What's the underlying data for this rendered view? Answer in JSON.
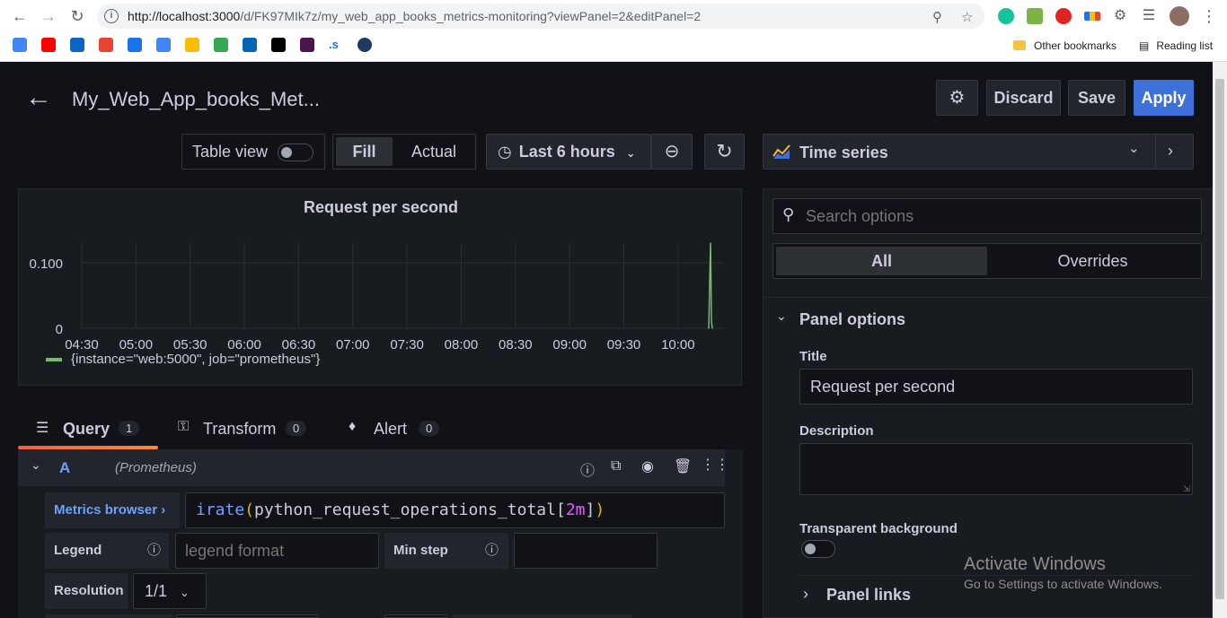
{
  "browser": {
    "url_host": "http://localhost:3000",
    "url_path": "/d/FK97MIk7z/my_web_app_books_metrics-monitoring?viewPanel=2&editPanel=2",
    "bookmarks_other": "Other bookmarks",
    "bookmarks_reading": "Reading list"
  },
  "header": {
    "title": "My_Web_App_books_Met...",
    "discard": "Discard",
    "save": "Save",
    "apply": "Apply"
  },
  "toolbar": {
    "table_view": "Table view",
    "fill": "Fill",
    "actual": "Actual",
    "time_range": "Last 6 hours",
    "viz_type": "Time series"
  },
  "chart_data": {
    "type": "line",
    "title": "Request per second",
    "x_ticks": [
      "04:30",
      "05:00",
      "05:30",
      "06:00",
      "06:30",
      "07:00",
      "07:30",
      "08:00",
      "08:30",
      "09:00",
      "09:30",
      "10:00"
    ],
    "y_ticks": [
      "0",
      "0.100"
    ],
    "ylim": [
      0,
      0.13
    ],
    "series": [
      {
        "name": "{instance=\"web:5000\", job=\"prometheus\"}",
        "color": "#73bf69",
        "x": [
          "10:17",
          "10:17:30",
          "10:18",
          "10:18:30",
          "10:19"
        ],
        "values": [
          0,
          0.07,
          0.13,
          0.01,
          0
        ]
      }
    ],
    "legend": "bottom-left",
    "grid": true
  },
  "tabs": [
    {
      "label": "Query",
      "count": "1"
    },
    {
      "label": "Transform",
      "count": "0"
    },
    {
      "label": "Alert",
      "count": "0"
    }
  ],
  "query": {
    "ref": "A",
    "datasource": "(Prometheus)",
    "metrics_browser": "Metrics browser",
    "expr_fn": "irate",
    "expr_metric": "python_request_operations_total",
    "expr_range": "2m",
    "legend_label": "Legend",
    "legend_placeholder": "legend format",
    "min_step_label": "Min step",
    "resolution_label": "Resolution",
    "resolution_value": "1/1"
  },
  "options": {
    "search_placeholder": "Search options",
    "tab_all": "All",
    "tab_overrides": "Overrides",
    "section": "Panel options",
    "title_label": "Title",
    "title_value": "Request per second",
    "description_label": "Description",
    "transparent_label": "Transparent background",
    "panel_links": "Panel links"
  },
  "watermark": {
    "line1": "Activate Windows",
    "line2": "Go to Settings to activate Windows."
  }
}
